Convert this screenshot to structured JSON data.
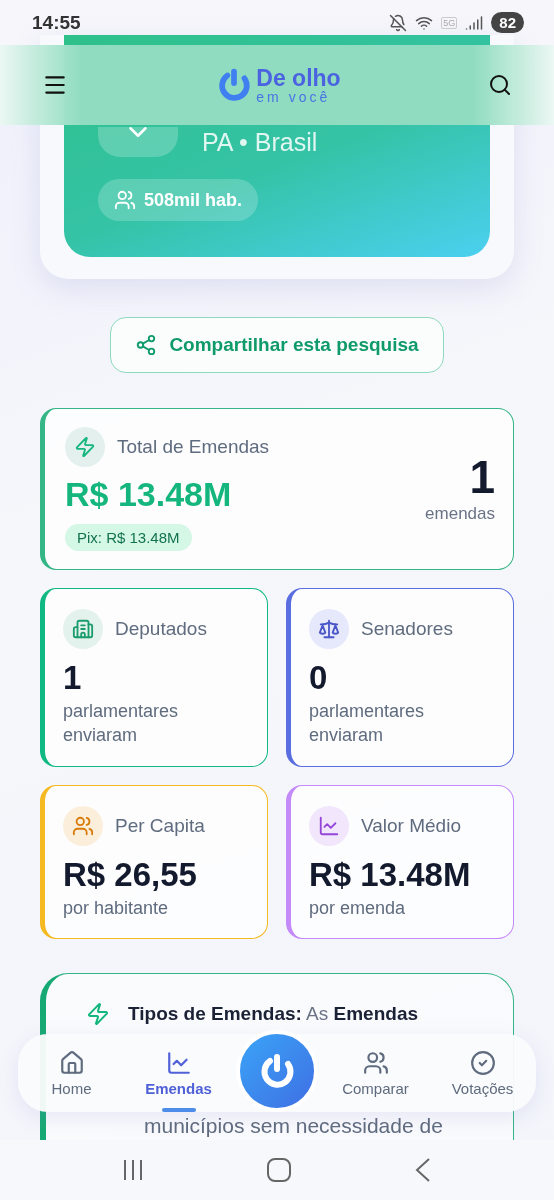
{
  "status_bar": {
    "time": "14:55",
    "network": "5G",
    "battery": "82"
  },
  "header": {
    "logo_title": "De olho",
    "logo_subtitle": "em você"
  },
  "location": {
    "region": "PA • Brasil",
    "population": "508mil hab."
  },
  "share_button": "Compartilhar esta pesquisa",
  "total": {
    "title": "Total de Emendas",
    "value": "R$ 13.48M",
    "pix": "Pix: R$ 13.48M",
    "count": "1",
    "count_label": "emendas"
  },
  "stats": [
    {
      "kind": "building",
      "title": "Deputados",
      "value": "1",
      "caption": "parlamentares enviaram",
      "color": "#10b981"
    },
    {
      "kind": "scale",
      "title": "Senadores",
      "value": "0",
      "caption": "parlamentares enviaram",
      "color": "#5b6ee1"
    },
    {
      "kind": "users",
      "title": "Per Capita",
      "value": "R$ 26,55",
      "caption": "por habitante",
      "color": "#f5b921"
    },
    {
      "kind": "chart",
      "title": "Valor Médio",
      "value": "R$ 13.48M",
      "caption": "por emenda",
      "color": "#c58af9"
    }
  ],
  "info": {
    "heading": "**Tipos de Emendas:** As **Emendas**",
    "line": "municípios sem necessidade de"
  },
  "bottom_nav": [
    {
      "kind": "home",
      "label": "Home",
      "selected": false
    },
    {
      "kind": "chart",
      "label": "Emendas",
      "selected": true
    },
    {
      "kind": "users",
      "label": "Comparar",
      "selected": false
    },
    {
      "kind": "check",
      "label": "Votações",
      "selected": false
    }
  ]
}
